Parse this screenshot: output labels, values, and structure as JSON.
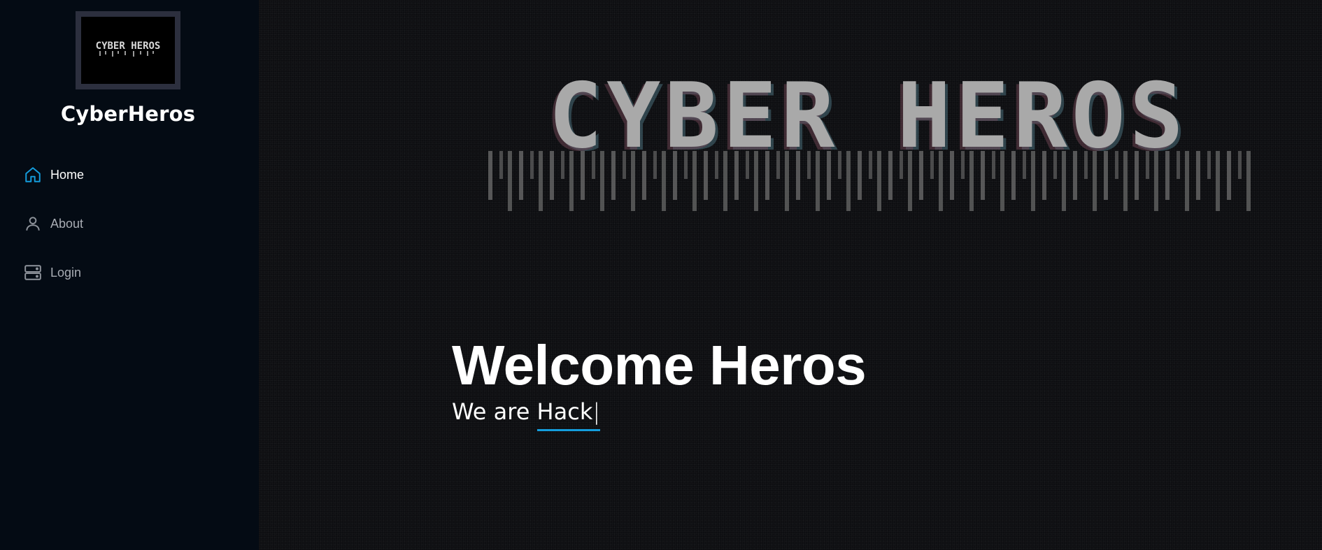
{
  "sidebar": {
    "brand": "CyberHeros",
    "logo_text": "CYBER HEROS",
    "nav": [
      {
        "label": "Home",
        "icon": "home-icon",
        "active": true
      },
      {
        "label": "About",
        "icon": "user-icon",
        "active": false
      },
      {
        "label": "Login",
        "icon": "server-icon",
        "active": false
      }
    ]
  },
  "hero": {
    "logo_text": "CYBER HEROS",
    "title": "Welcome Heros",
    "subtitle_prefix": "We are ",
    "typed_word": "Hack",
    "cursor": "|"
  },
  "colors": {
    "accent": "#149ddd",
    "sidebar_bg": "#040b14",
    "main_bg": "#0d0e11"
  }
}
